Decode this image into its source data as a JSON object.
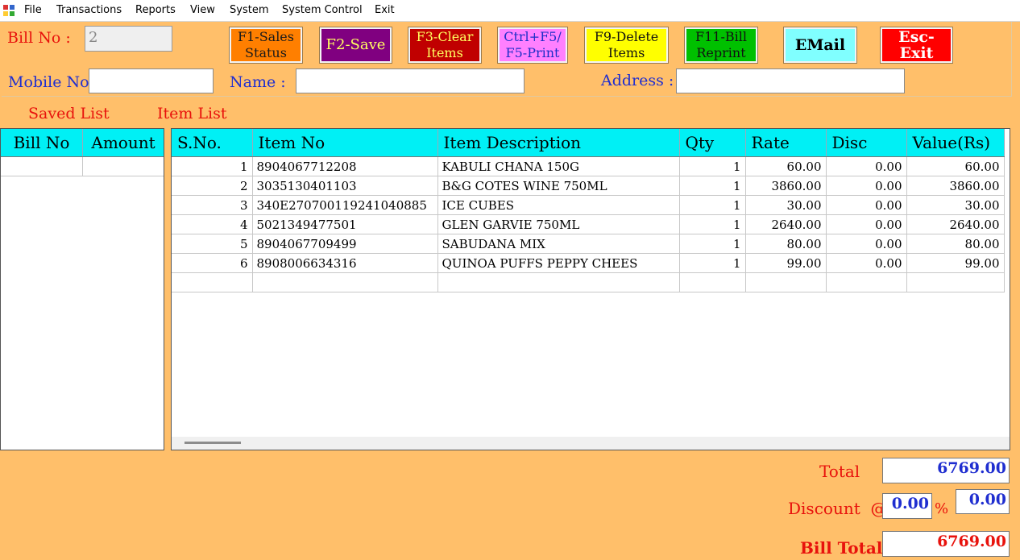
{
  "menu": [
    "File",
    "Transactions",
    "Reports",
    "View",
    "System",
    "System Control",
    "Exit"
  ],
  "header": {
    "bill_no_label": "Bill No :",
    "bill_no_value": "2",
    "mobile_label": "Mobile No:",
    "mobile_value": "",
    "name_label": "Name :",
    "name_value": "",
    "address_label": "Address :",
    "address_value": ""
  },
  "buttons": {
    "f1": "F1-Sales\nStatus",
    "f2": "F2-Save",
    "f3": "F3-Clear\nItems",
    "f5": "Ctrl+F5/\nF5-Print",
    "f9": "F9-Delete\nItems",
    "f11": "F11-Bill\nReprint",
    "email": "EMail",
    "esc": "Esc-Exit"
  },
  "colors": {
    "background": "#FFBF6A",
    "header_cyan": "#00F0F5",
    "f1": "#FF7F00",
    "f2": "#800080",
    "f3": "#C00000",
    "f5": "#FF80FF",
    "f9": "#FFFF00",
    "f11": "#00C000",
    "email": "#80FFFF",
    "esc": "#FF0000"
  },
  "saved_list": {
    "title": "Saved List",
    "columns": [
      "Bill No",
      "Amount"
    ]
  },
  "item_list": {
    "title": "Item List",
    "columns": [
      "S.No.",
      "Item No",
      "Item Description",
      "Qty",
      "Rate",
      "Disc",
      "Value(Rs)"
    ],
    "rows": [
      [
        "1",
        "8904067712208",
        "KABULI CHANA 150G",
        "1",
        "60.00",
        "0.00",
        "60.00"
      ],
      [
        "2",
        "3035130401103",
        "B&G COTES WINE 750ML",
        "1",
        "3860.00",
        "0.00",
        "3860.00"
      ],
      [
        "3",
        "340E270700119241040885",
        "ICE CUBES",
        "1",
        "30.00",
        "0.00",
        "30.00"
      ],
      [
        "4",
        "5021349477501",
        "GLEN GARVIE 750ML",
        "1",
        "2640.00",
        "0.00",
        "2640.00"
      ],
      [
        "5",
        "8904067709499",
        "SABUDANA MIX",
        "1",
        "80.00",
        "0.00",
        "80.00"
      ],
      [
        "6",
        "8908006634316",
        "QUINOA PUFFS PEPPY CHEES",
        "1",
        "99.00",
        "0.00",
        "99.00"
      ]
    ]
  },
  "totals": {
    "total_label": "Total",
    "total_value": "6769.00",
    "discount_label": "Discount  @",
    "discount_pct": "0.00",
    "pct_sign": "%",
    "discount_value": "0.00",
    "bill_total_label": "Bill Total",
    "bill_total_value": "6769.00"
  }
}
